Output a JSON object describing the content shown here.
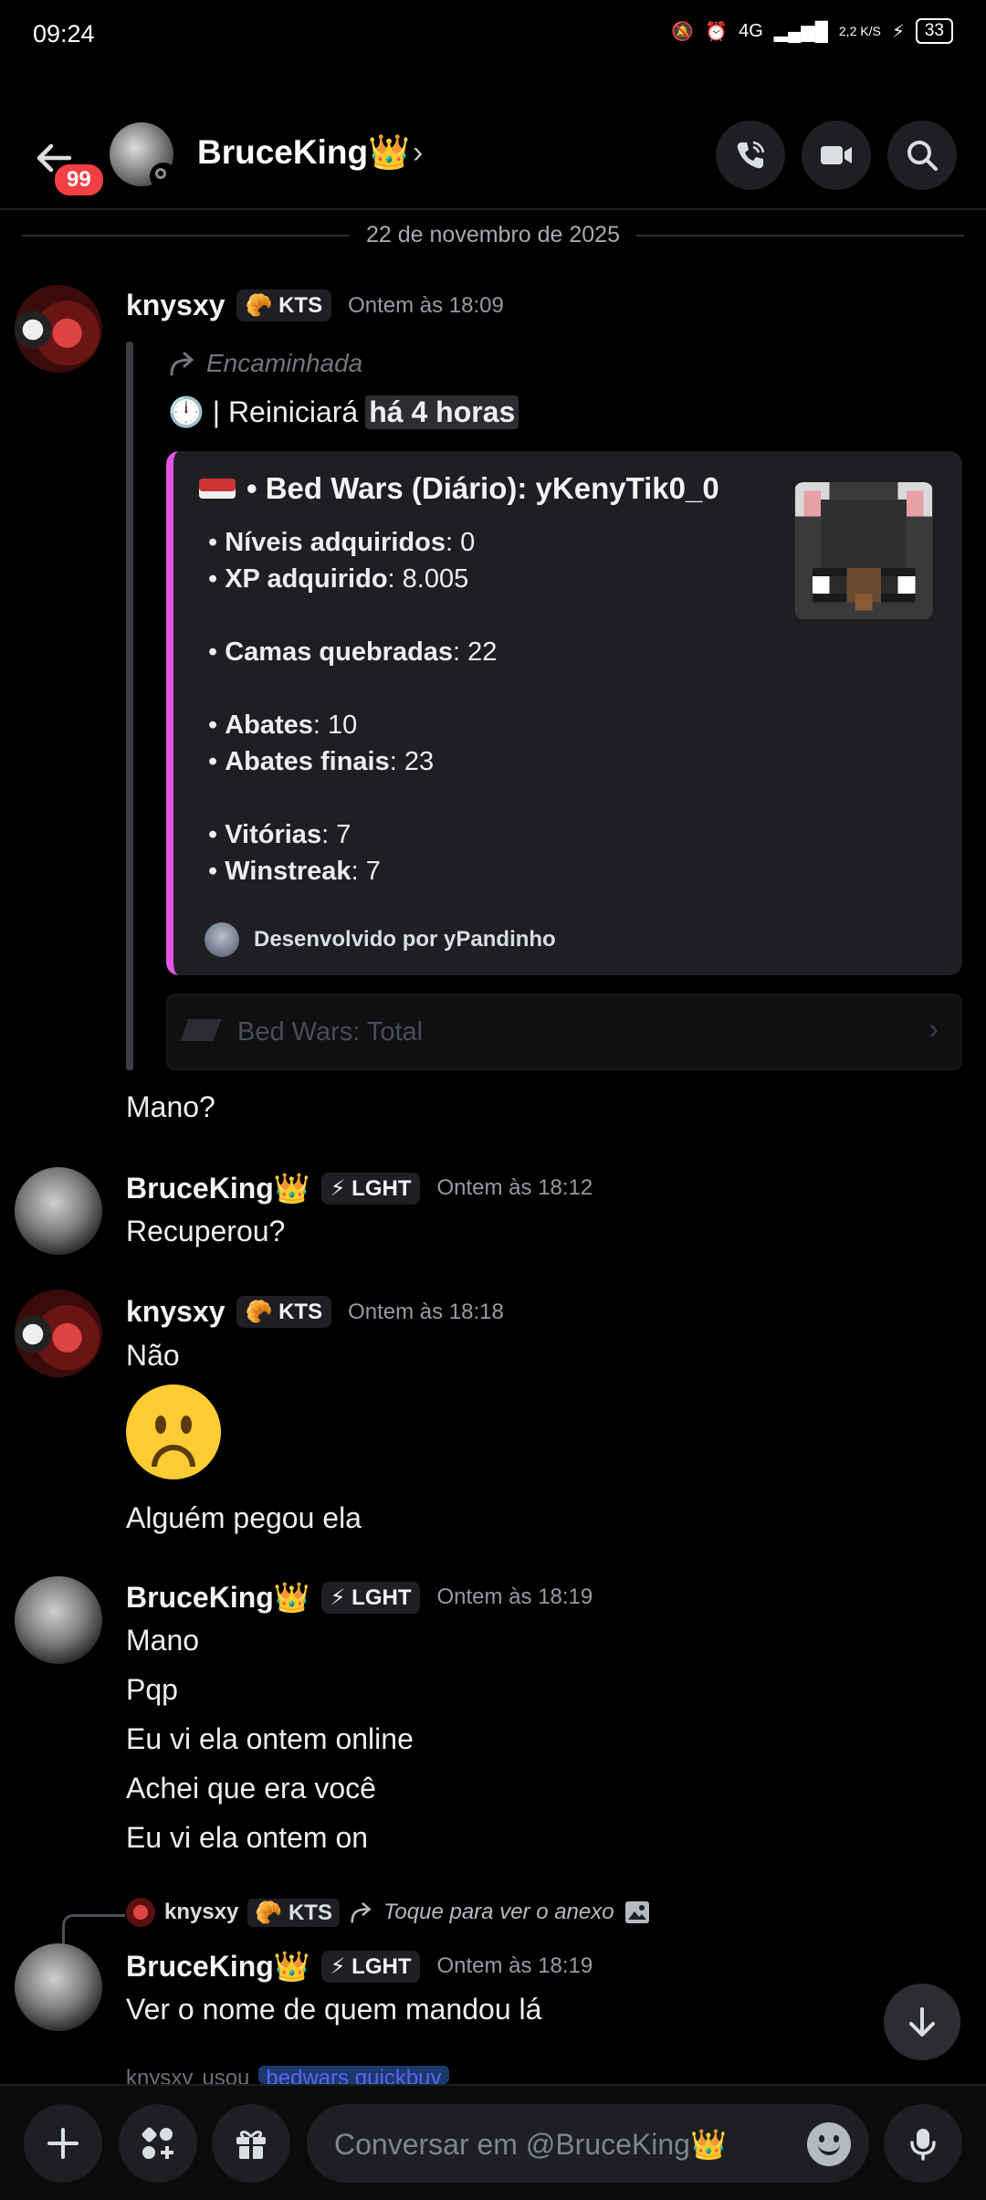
{
  "status_bar": {
    "time": "09:24",
    "network": "4G",
    "speed": "2,2 K/S",
    "battery": "33"
  },
  "header": {
    "unread_badge": "99",
    "name": "BruceKing👑",
    "chevron": "›"
  },
  "date_separator": "22 de novembro de 2025",
  "messages": [
    {
      "author": "knysxy",
      "tag": "🥐 KTS",
      "time": "Ontem às 18:09",
      "forward": {
        "label": "Encaminhada",
        "line_prefix": "🕛 | Reiniciará",
        "line_highlight": "há 4 horas",
        "embed": {
          "title": "• Bed Wars (Diário): yKenyTik0_0",
          "lines": [
            {
              "key": "Níveis adquiridos",
              "value": ": 0"
            },
            {
              "key": "XP adquirido",
              "value": ": 8.005"
            },
            {
              "key": "Camas quebradas",
              "value": ": 22"
            },
            {
              "key": "Abates",
              "value": ": 10"
            },
            {
              "key": "Abates finais",
              "value": ": 23"
            },
            {
              "key": "Vitórias",
              "value": ": 7"
            },
            {
              "key": "Winstreak",
              "value": ": 7"
            }
          ],
          "bullet": "•",
          "footer": "Desenvolvido por yPandinho"
        },
        "collapsed_embed": "Bed Wars: Total"
      },
      "after_text": "Mano?"
    },
    {
      "author": "BruceKing👑",
      "tag": "⚡ LGHT",
      "time": "Ontem às 18:12",
      "lines": [
        "Recuperou?"
      ]
    },
    {
      "author": "knysxy",
      "tag": "🥐 KTS",
      "time": "Ontem às 18:18",
      "lines": [
        "Não",
        "Alguém pegou ela"
      ]
    },
    {
      "author": "BruceKing👑",
      "tag": "⚡ LGHT",
      "time": "Ontem às 18:19",
      "lines": [
        "Mano",
        "Pqp",
        "Eu vi ela ontem online",
        "Achei que era você",
        "Eu vi ela ontem on"
      ]
    },
    {
      "reply": {
        "author": "knysxy",
        "tag": "🥐 KTS",
        "text": "Toque para ver o anexo"
      },
      "author": "BruceKing👑",
      "tag": "⚡ LGHT",
      "time": "Ontem às 18:19",
      "lines": [
        "Ver o nome de quem mandou lá"
      ]
    }
  ],
  "peek": {
    "author": "knysxy",
    "text": "usou",
    "command": "bedwars quickbuy"
  },
  "composer": {
    "placeholder": "Conversar em @BruceKing👑"
  },
  "colors": {
    "embed_accent": "#e354e6",
    "badge": "#f23f43",
    "background": "#000000"
  }
}
